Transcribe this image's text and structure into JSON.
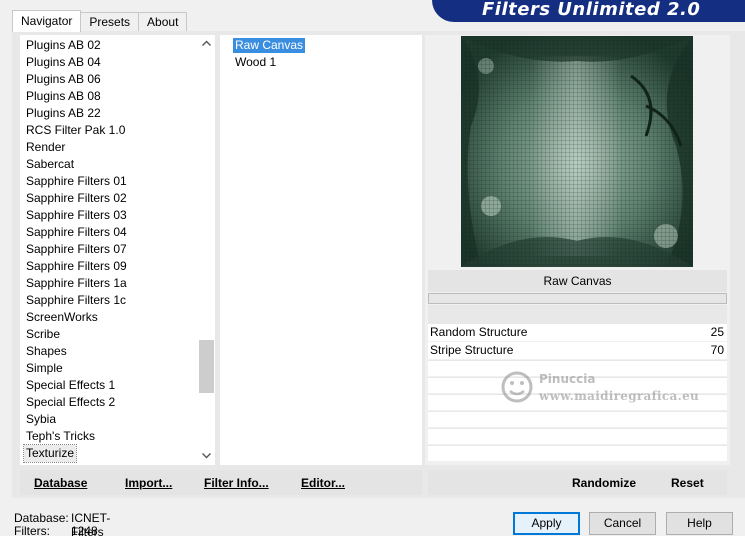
{
  "banner": {
    "title": "Filters Unlimited 2.0"
  },
  "tabs": [
    {
      "label": "Navigator",
      "active": true
    },
    {
      "label": "Presets",
      "active": false
    },
    {
      "label": "About",
      "active": false
    }
  ],
  "categories": {
    "items": [
      "Plugins AB 02",
      "Plugins AB 04",
      "Plugins AB 06",
      "Plugins AB 08",
      "Plugins AB 22",
      "RCS Filter Pak 1.0",
      "Render",
      "Sabercat",
      "Sapphire Filters 01",
      "Sapphire Filters 02",
      "Sapphire Filters 03",
      "Sapphire Filters 04",
      "Sapphire Filters 07",
      "Sapphire Filters 09",
      "Sapphire Filters 1a",
      "Sapphire Filters 1c",
      "ScreenWorks",
      "Scribe",
      "Shapes",
      "Simple",
      "Special Effects 1",
      "Special Effects 2",
      "Sybia",
      "Teph's Tricks",
      "Texturize"
    ],
    "selected": "Texturize"
  },
  "filters": {
    "items": [
      "Raw Canvas",
      "Wood 1"
    ],
    "selected": "Raw Canvas"
  },
  "preview": {
    "filter_name": "Raw Canvas"
  },
  "parameters": [
    {
      "label": "Random Structure",
      "value": "25"
    },
    {
      "label": "Stripe Structure",
      "value": "70"
    }
  ],
  "watermark": {
    "name": "Pinuccia",
    "url": "www.maidiregrafica.eu"
  },
  "left_buttons": {
    "database": "Database",
    "import": "Import...",
    "filter_info": "Filter Info...",
    "editor": "Editor..."
  },
  "right_buttons": {
    "randomize": "Randomize",
    "reset": "Reset"
  },
  "status": {
    "database_label": "Database:",
    "database_value": "ICNET-Filters",
    "filters_label": "Filters:",
    "filters_value": "1248"
  },
  "dialog_buttons": {
    "apply": "Apply",
    "cancel": "Cancel",
    "help": "Help"
  },
  "colors": {
    "banner": "#142e82",
    "selection": "#3a8ee0",
    "default_button_border": "#0078d7"
  },
  "icons": {
    "scroll_up": "chevron-up-icon",
    "scroll_down": "chevron-down-icon"
  }
}
